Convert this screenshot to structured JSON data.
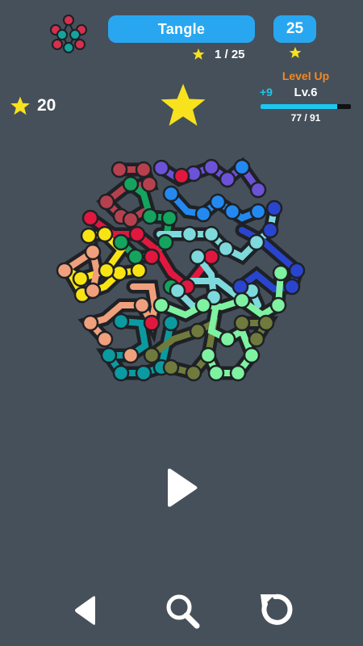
{
  "header": {
    "title": "Tangle",
    "level_count": "25",
    "progress": "1 / 25"
  },
  "score": {
    "stars": "20"
  },
  "level": {
    "label": "Level Up",
    "xp_gain": "+9",
    "level_name": "Lv.6",
    "xp_text": "77 / 91",
    "xp_fraction": 0.846
  },
  "colors": {
    "background": "#46505a",
    "accent": "#28a7f0",
    "star": "#f7e21d",
    "level_up": "#f08a24",
    "xp": "#1cc7f0"
  },
  "icons": {
    "logo": "molecule-logo-icon",
    "star": "star-icon",
    "play": "play-icon",
    "back": "back-icon",
    "hint": "search-icon",
    "restart": "restart-icon"
  }
}
